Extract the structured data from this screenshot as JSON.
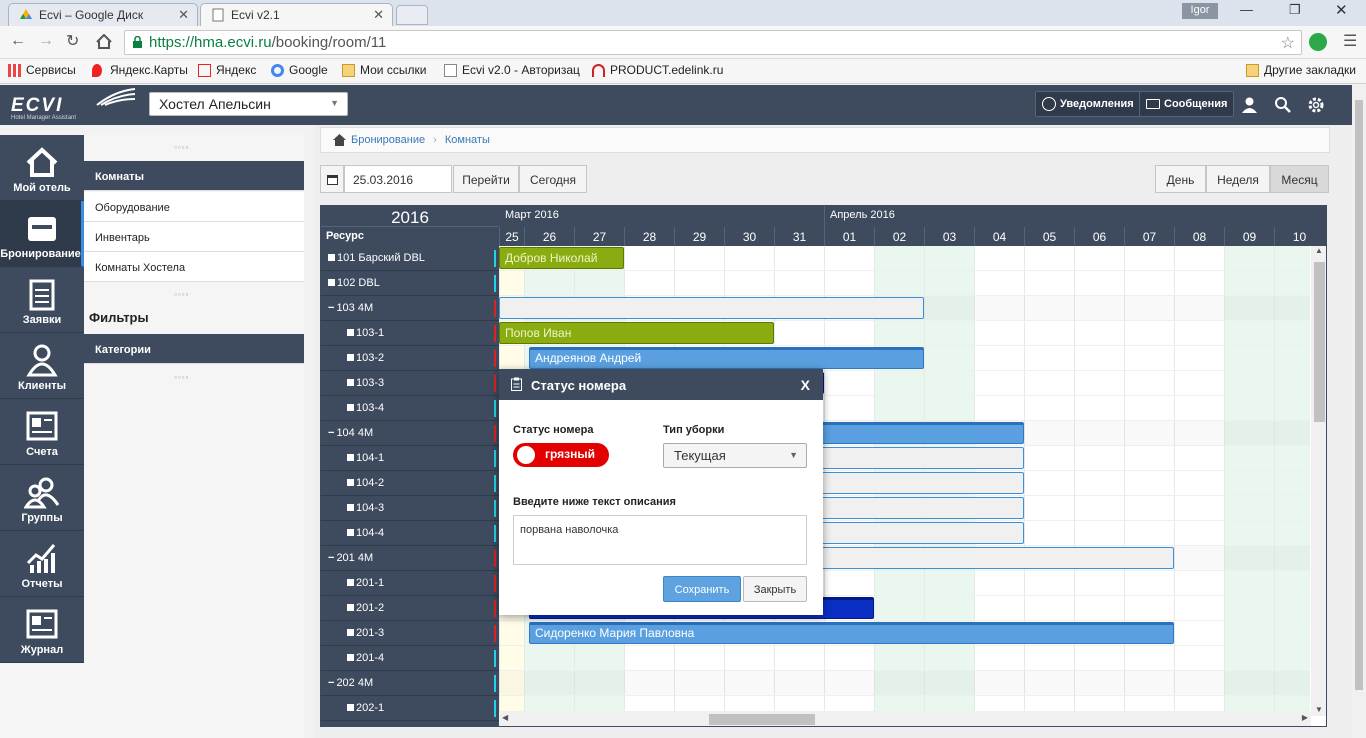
{
  "browser": {
    "tabs": [
      {
        "title": "Ecvi – Google Диск",
        "active": false
      },
      {
        "title": "Ecvi v2.1",
        "active": true
      }
    ],
    "user": "Igor",
    "url_host": "https://hma.ecvi.ru",
    "url_path": "/booking/room/11",
    "bookmarks": [
      "Сервисы",
      "Яндекс.Карты",
      "Яндекс",
      "Google",
      "Мои ссылки",
      "Ecvi v2.0 - Авторизац",
      "PRODUCT.edelink.ru"
    ],
    "other_bookmarks": "Другие закладки"
  },
  "app": {
    "logo": "ECVI",
    "logo_sub": "Hotel Manager Assistant",
    "hotel_select": "Хостел Апельсин",
    "notifications": "Уведомления",
    "messages": "Сообщения"
  },
  "nav": [
    {
      "label": "Мой отель",
      "icon": "home-icon"
    },
    {
      "label": "Бронирование",
      "icon": "inbox-icon"
    },
    {
      "label": "Заявки",
      "icon": "clipboard-icon"
    },
    {
      "label": "Клиенты",
      "icon": "user-icon"
    },
    {
      "label": "Счета",
      "icon": "invoice-icon"
    },
    {
      "label": "Группы",
      "icon": "group-icon"
    },
    {
      "label": "Отчеты",
      "icon": "chart-icon"
    },
    {
      "label": "Журнал",
      "icon": "journal-icon"
    }
  ],
  "submenu": {
    "items": [
      "Комнаты",
      "Оборудование",
      "Инвентарь",
      "Комнаты Хостела"
    ],
    "filters": "Фильтры",
    "categories": "Категории"
  },
  "breadcrumb": [
    "Бронирование",
    "Комнаты"
  ],
  "toolbar": {
    "date": "25.03.2016",
    "go": "Перейти",
    "today": "Сегодня",
    "views": [
      "День",
      "Неделя",
      "Месяц"
    ],
    "active_view": "Месяц"
  },
  "scheduler": {
    "year": "2016",
    "resource_header": "Ресурс",
    "months": [
      "Март 2016",
      "Апрель 2016"
    ],
    "days": [
      "25",
      "26",
      "27",
      "28",
      "29",
      "30",
      "31",
      "01",
      "02",
      "03",
      "04",
      "05",
      "06",
      "07",
      "08",
      "09",
      "10"
    ],
    "rows": [
      {
        "label": "101 Барский DBL",
        "type": "room",
        "marker": "cyan"
      },
      {
        "label": "102 DBL",
        "type": "room",
        "marker": "cyan"
      },
      {
        "label": "103 4M",
        "type": "group",
        "marker": "red"
      },
      {
        "label": "103-1",
        "type": "bed",
        "marker": "red"
      },
      {
        "label": "103-2",
        "type": "bed",
        "marker": "red"
      },
      {
        "label": "103-3",
        "type": "bed",
        "marker": "red"
      },
      {
        "label": "103-4",
        "type": "bed",
        "marker": "cyan"
      },
      {
        "label": "104 4M",
        "type": "group",
        "marker": "red"
      },
      {
        "label": "104-1",
        "type": "bed",
        "marker": "cyan"
      },
      {
        "label": "104-2",
        "type": "bed",
        "marker": "cyan"
      },
      {
        "label": "104-3",
        "type": "bed",
        "marker": "cyan"
      },
      {
        "label": "104-4",
        "type": "bed",
        "marker": "cyan"
      },
      {
        "label": "201 4M",
        "type": "group",
        "marker": "red"
      },
      {
        "label": "201-1",
        "type": "bed",
        "marker": "red"
      },
      {
        "label": "201-2",
        "type": "bed",
        "marker": "red"
      },
      {
        "label": "201-3",
        "type": "bed",
        "marker": "red"
      },
      {
        "label": "201-4",
        "type": "bed",
        "marker": "cyan"
      },
      {
        "label": "202 4M",
        "type": "group",
        "marker": "cyan"
      },
      {
        "label": "202-1",
        "type": "bed",
        "marker": "cyan"
      }
    ],
    "events": [
      {
        "row": 0,
        "start": 0,
        "end": 3,
        "style": "green",
        "label": "Добров Николай"
      },
      {
        "row": 2,
        "start": 0,
        "end": 9,
        "style": "grey",
        "label": ""
      },
      {
        "row": 3,
        "start": 0,
        "end": 6,
        "style": "green",
        "label": "Попов Иван"
      },
      {
        "row": 4,
        "start": 1.1,
        "end": 9,
        "style": "blue",
        "label": "Андреянов Андрей"
      },
      {
        "row": 5,
        "start": 6,
        "end": 7,
        "style": "dblue",
        "label": ""
      },
      {
        "row": 7,
        "start": 6,
        "end": 11,
        "style": "blue",
        "label": "ич"
      },
      {
        "row": 8,
        "start": 6,
        "end": 11,
        "style": "grey",
        "label": ""
      },
      {
        "row": 9,
        "start": 6,
        "end": 11,
        "style": "grey",
        "label": ""
      },
      {
        "row": 10,
        "start": 6,
        "end": 11,
        "style": "grey",
        "label": ""
      },
      {
        "row": 11,
        "start": 6,
        "end": 11,
        "style": "grey",
        "label": ""
      },
      {
        "row": 12,
        "start": 6,
        "end": 14,
        "style": "grey",
        "label": ""
      },
      {
        "row": 14,
        "start": 1.1,
        "end": 8,
        "style": "dblue",
        "label": ""
      },
      {
        "row": 15,
        "start": 1.1,
        "end": 14,
        "style": "blue",
        "label": "Сидоренко Мария Павловна"
      }
    ]
  },
  "dialog": {
    "title": "Статус номера",
    "close": "X",
    "status_label": "Статус номера",
    "status_value": "грязный",
    "cleaning_label": "Тип уборки",
    "cleaning_value": "Текущая",
    "desc_label": "Введите ниже текст описания",
    "desc_value": "порвана наволочка",
    "save": "Сохранить",
    "cancel": "Закрыть"
  }
}
